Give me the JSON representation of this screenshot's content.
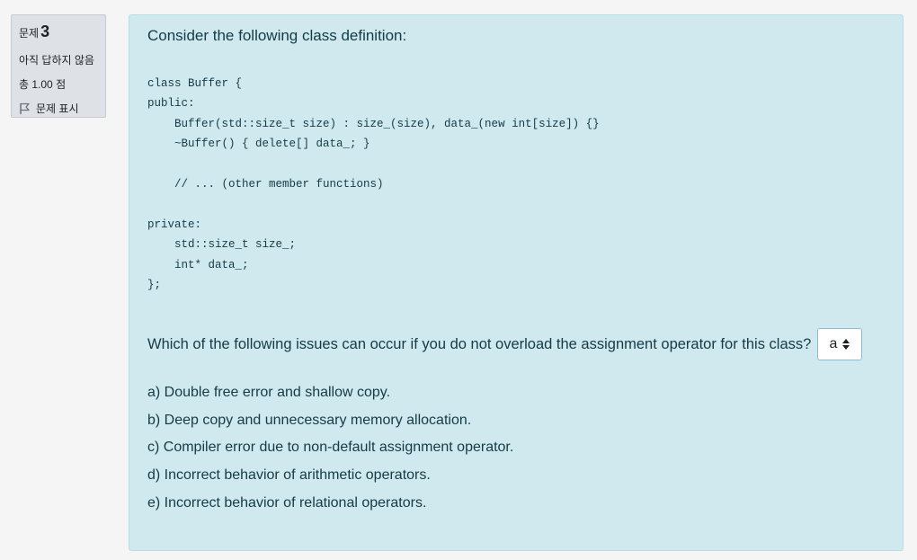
{
  "info": {
    "question_label": "문제",
    "question_number": "3",
    "status": "아직 답하지 않음",
    "marks": "총 1.00 점",
    "flag_label": "문제 표시"
  },
  "question": {
    "intro": "Consider the following class definition:",
    "code": "class Buffer {\npublic:\n    Buffer(std::size_t size) : size_(size), data_(new int[size]) {}\n    ~Buffer() { delete[] data_; }\n\n    // ... (other member functions)\n\nprivate:\n    std::size_t size_;\n    int* data_;\n};",
    "prompt": "Which of the following issues can occur if you do not overload the assignment operator for this class?",
    "select_value": "a",
    "options": [
      "a) Double free error and shallow copy.",
      "b) Deep copy and unnecessary memory allocation.",
      "c) Compiler error due to non-default assignment operator.",
      "d) Incorrect behavior of arithmetic operators.",
      "e) Incorrect behavior of relational operators."
    ]
  },
  "colors": {
    "content_bg": "#cfe9ee",
    "info_bg": "#dee2e6",
    "text": "#143b47"
  }
}
